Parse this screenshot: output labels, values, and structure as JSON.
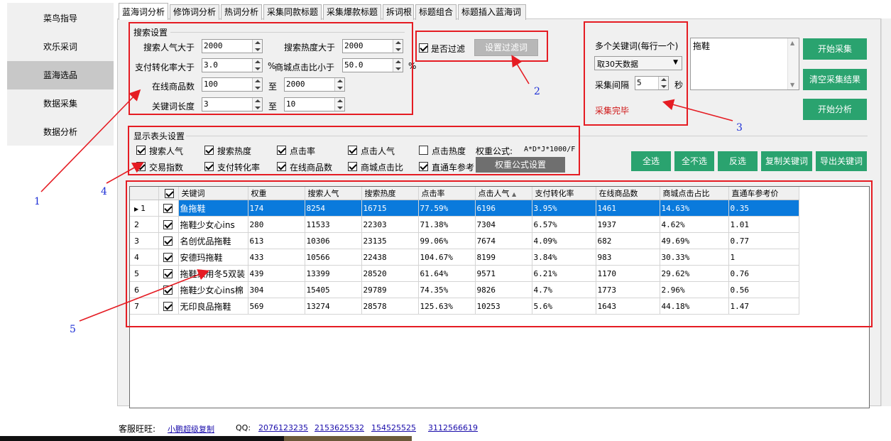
{
  "left_nav": [
    {
      "label": "菜鸟指导",
      "active": false
    },
    {
      "label": "欢乐采词",
      "active": false
    },
    {
      "label": "蓝海选品",
      "active": true
    },
    {
      "label": "数据采集",
      "active": false
    },
    {
      "label": "数据分析",
      "active": false
    }
  ],
  "tabs": [
    "蓝海词分析",
    "修饰词分析",
    "热词分析",
    "采集同款标题",
    "采集爆款标题",
    "拆词根",
    "标题组合",
    "标题插入蓝海词"
  ],
  "search_settings": {
    "title": "搜索设置",
    "popularity_gt_label": "搜索人气大于",
    "popularity_gt": "2000",
    "heat_gt_label": "搜索热度大于",
    "heat_gt": "2000",
    "pay_rate_gt_label": "支付转化率大于",
    "pay_rate_gt": "3.0",
    "pct1": "%",
    "mall_ctr_lt_label": "商城点击比小于",
    "mall_ctr_lt": "50.0",
    "pct2": "%",
    "online_goods_label": "在线商品数",
    "online_goods_min": "100",
    "to1": "至",
    "online_goods_max": "2000",
    "kw_len_label": "关键词长度",
    "kw_len_min": "3",
    "to2": "至",
    "kw_len_max": "10"
  },
  "filter": {
    "checkbox_label": "是否过滤",
    "checked": true,
    "button": "设置过滤词"
  },
  "multi_kw": {
    "label": "多个关键词(每行一个)",
    "period": "取30天数据",
    "interval_label": "采集间隔",
    "interval": "5",
    "unit": "秒",
    "status": "采集完毕",
    "textarea_value": "拖鞋"
  },
  "right_buttons": [
    "开始采集",
    "清空采集结果",
    "开始分析"
  ],
  "display_settings": {
    "title": "显示表头设置",
    "row1": [
      {
        "label": "搜索人气",
        "checked": true
      },
      {
        "label": "搜索热度",
        "checked": true
      },
      {
        "label": "点击率",
        "checked": true
      },
      {
        "label": "点击人气",
        "checked": true
      },
      {
        "label": "点击热度",
        "checked": false
      }
    ],
    "row2": [
      {
        "label": "交易指数",
        "checked": true
      },
      {
        "label": "支付转化率",
        "checked": true
      },
      {
        "label": "在线商品数",
        "checked": true
      },
      {
        "label": "商城点击比",
        "checked": true
      },
      {
        "label": "直通车参考",
        "checked": true
      }
    ],
    "formula_label": "权重公式:",
    "formula": "A*D*J*1000/F",
    "formula_button": "权重公式设置"
  },
  "action_buttons": [
    "全选",
    "全不选",
    "反选",
    "复制关键词",
    "导出关键词"
  ],
  "table": {
    "headers": [
      "关键词",
      "权重",
      "搜索人气",
      "搜索热度",
      "点击率",
      "点击人气",
      "支付转化率",
      "在线商品数",
      "商城点击占比",
      "直通车参考价"
    ],
    "rows": [
      {
        "n": "1",
        "selected": true,
        "cells": [
          "鱼拖鞋",
          "174",
          "8254",
          "16715",
          "77.59%",
          "6196",
          "3.95%",
          "1461",
          "14.63%",
          "0.35"
        ]
      },
      {
        "n": "2",
        "selected": false,
        "cells": [
          "拖鞋少女心ins",
          "280",
          "11533",
          "22303",
          "71.38%",
          "7304",
          "6.57%",
          "1937",
          "4.62%",
          "1.01"
        ]
      },
      {
        "n": "3",
        "selected": false,
        "cells": [
          "名创优品拖鞋",
          "613",
          "10306",
          "23135",
          "99.06%",
          "7674",
          "4.09%",
          "682",
          "49.69%",
          "0.77"
        ]
      },
      {
        "n": "4",
        "selected": false,
        "cells": [
          "安德玛拖鞋",
          "433",
          "10566",
          "22438",
          "104.67%",
          "8199",
          "3.84%",
          "983",
          "30.33%",
          "1"
        ]
      },
      {
        "n": "5",
        "selected": false,
        "cells": [
          "拖鞋家用冬5双装",
          "439",
          "13399",
          "28520",
          "61.64%",
          "9571",
          "6.21%",
          "1170",
          "29.62%",
          "0.76"
        ]
      },
      {
        "n": "6",
        "selected": false,
        "cells": [
          "拖鞋少女心ins棉",
          "304",
          "15405",
          "29789",
          "74.35%",
          "9826",
          "4.7%",
          "1773",
          "2.96%",
          "0.56"
        ]
      },
      {
        "n": "7",
        "selected": false,
        "cells": [
          "无印良品拖鞋",
          "569",
          "13274",
          "28578",
          "125.63%",
          "10253",
          "5.6%",
          "1643",
          "44.18%",
          "1.47"
        ]
      }
    ]
  },
  "footer": {
    "service_label": "客服旺旺:",
    "service_link": "小鹏超级复制",
    "qq_label": "QQ:",
    "qq": [
      "2076123235",
      "2153625532",
      "154525525",
      "3112566619"
    ]
  },
  "annotations": [
    "1",
    "2",
    "3",
    "4",
    "5"
  ],
  "colors": {
    "red": "#e51c23",
    "green": "#2aa36f",
    "select": "#0a7adc",
    "annot": "#1d2fd6"
  }
}
